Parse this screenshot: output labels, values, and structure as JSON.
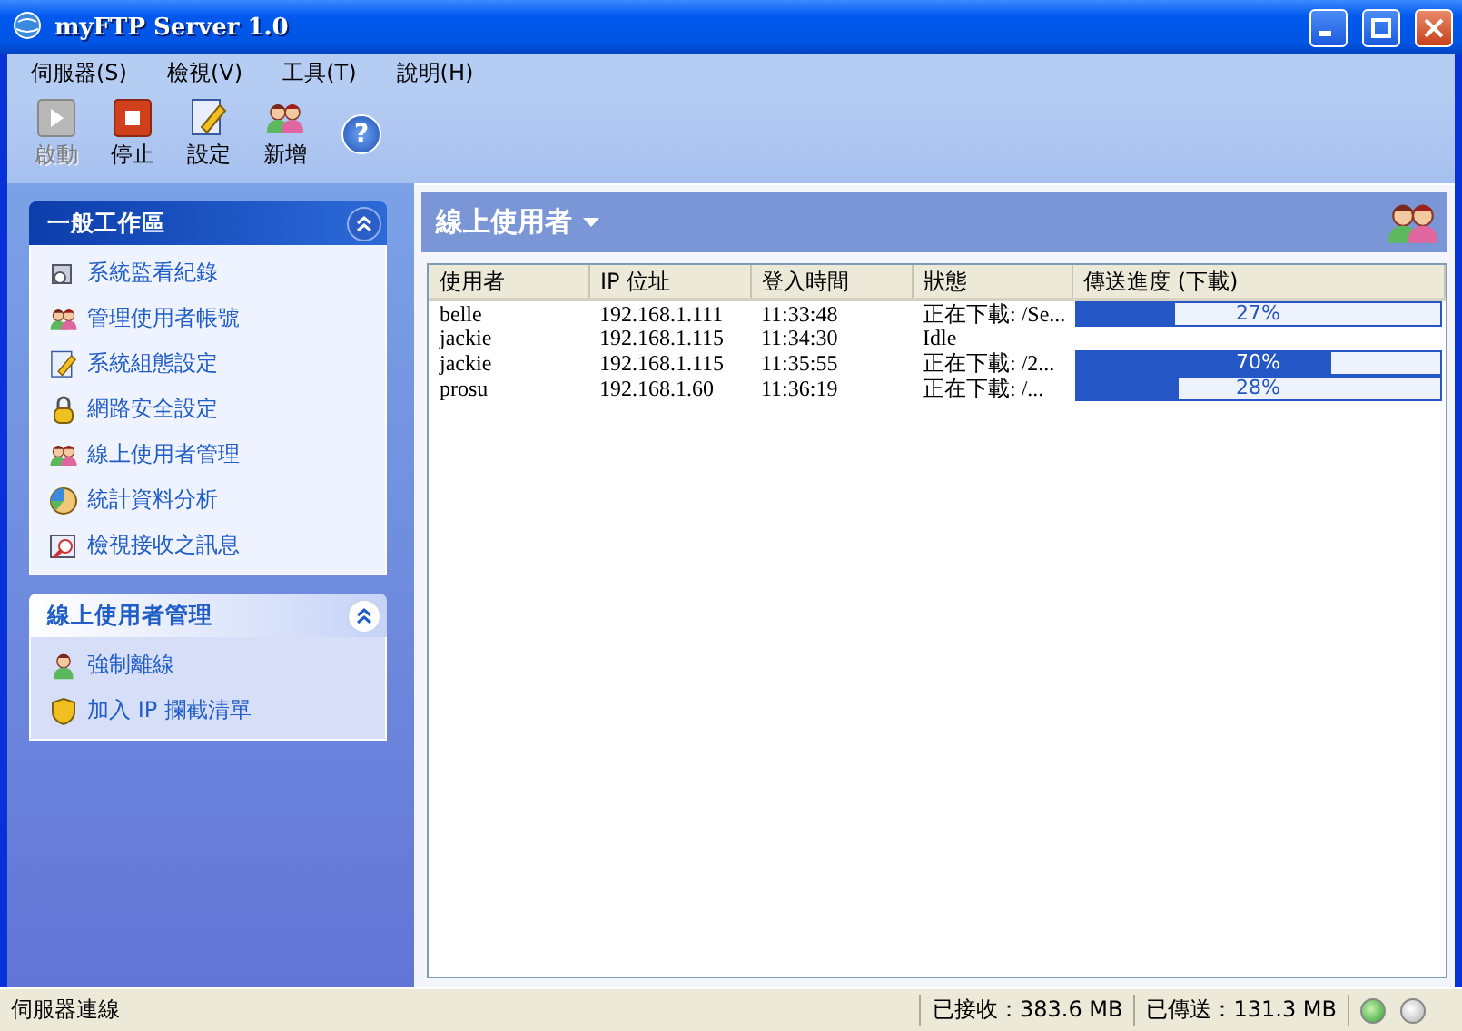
{
  "window": {
    "title": "myFTP Server 1.0"
  },
  "menu": [
    "伺服器(S)",
    "檢視(V)",
    "工具(T)",
    "說明(H)"
  ],
  "toolbar": [
    {
      "kind": "start",
      "label": "啟動",
      "disabled": true
    },
    {
      "kind": "stop",
      "label": "停止",
      "disabled": false
    },
    {
      "kind": "settings",
      "label": "設定",
      "disabled": false
    },
    {
      "kind": "add",
      "label": "新增",
      "disabled": false
    },
    {
      "kind": "help",
      "glyph": "?",
      "disabled": false
    }
  ],
  "task_panels": [
    {
      "title": "一般工作區",
      "kind": "primary",
      "expanded": true,
      "items": [
        "系統監看紀錄",
        "管理使用者帳號",
        "系統組態設定",
        "網路安全設定",
        "線上使用者管理",
        "統計資料分析",
        "檢視接收之訊息"
      ]
    },
    {
      "title": "線上使用者管理",
      "kind": "secondary",
      "expanded": true,
      "items": [
        "強制離線",
        "加入 IP 攔截清單"
      ]
    }
  ],
  "content": {
    "title": "線上使用者",
    "columns": [
      "使用者",
      "IP 位址",
      "登入時間",
      "狀態",
      "傳送進度 (下載)"
    ],
    "rows": [
      {
        "user": "belle",
        "ip": "192.168.1.111",
        "login_time": "11:33:48",
        "status": "正在下載: /Se...",
        "progress": {
          "level": 0.27,
          "reading": "27%"
        }
      },
      {
        "user": "jackie",
        "ip": "192.168.1.115",
        "login_time": "11:34:30",
        "status": "Idle"
      },
      {
        "user": "jackie",
        "ip": "192.168.1.115",
        "login_time": "11:35:55",
        "status": "正在下載: /2...",
        "progress": {
          "level": 0.7,
          "reading": "70%"
        }
      },
      {
        "user": "prosu",
        "ip": "192.168.1.60",
        "login_time": "11:36:19",
        "status": "正在下載: /...",
        "progress": {
          "level": 0.28,
          "reading": "28%"
        }
      }
    ]
  },
  "status_bar": {
    "text": "伺服器連線",
    "received": "已接收：383.6 MB",
    "sent": "已傳送：131.3 MB",
    "lights": [
      {
        "on": true
      },
      {
        "on": false
      }
    ]
  }
}
